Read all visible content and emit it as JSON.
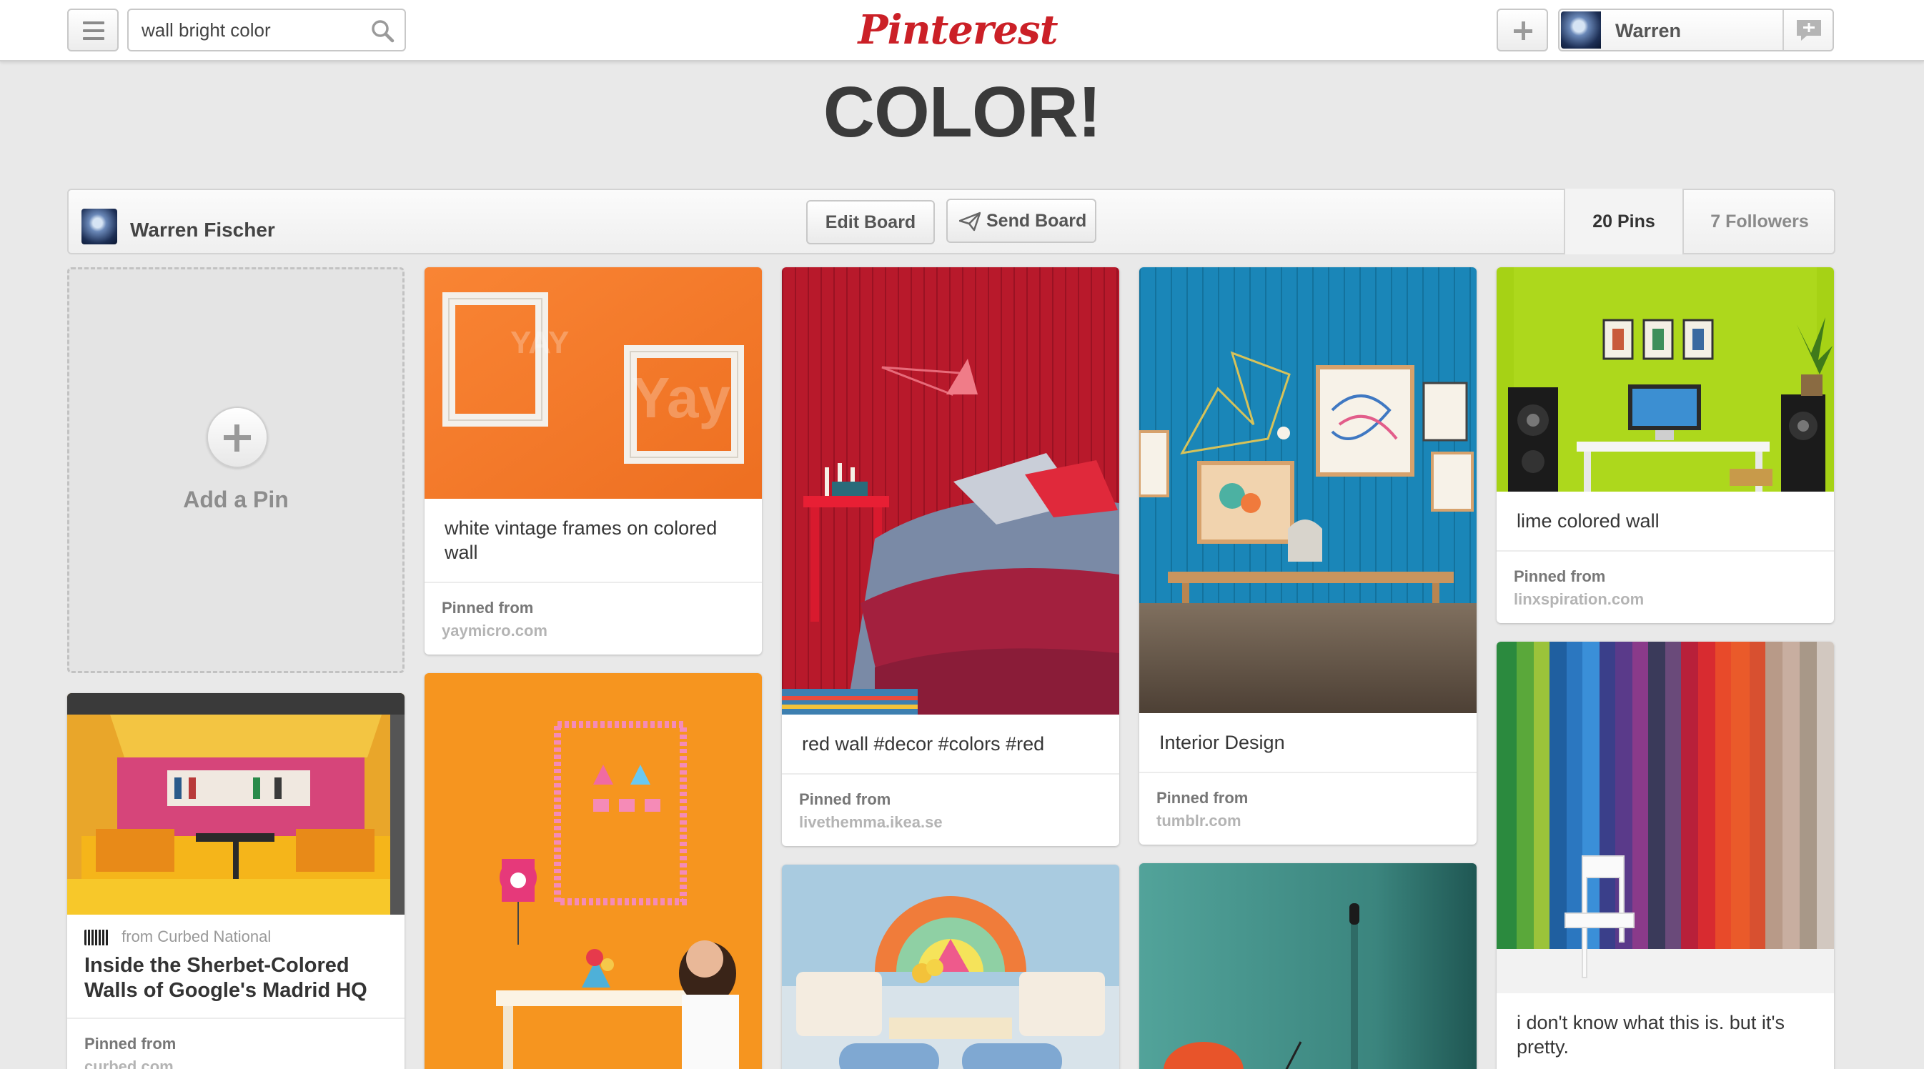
{
  "header": {
    "search": {
      "value": "wall bright color",
      "placeholder": "Search"
    },
    "logo": "Pinterest",
    "user": {
      "name": "Warren"
    }
  },
  "board": {
    "title": "COLOR!",
    "owner": "Warren Fischer",
    "edit_label": "Edit Board",
    "send_label": "Send Board",
    "pins_count": "20 Pins",
    "followers_count": "7 Followers"
  },
  "add_pin": {
    "label": "Add a Pin"
  },
  "pins": [
    {
      "image": "white-picture-frames-on-orange-wall",
      "description": "white vintage frames on colored wall",
      "pinned_label": "Pinned from",
      "source": "yaymicro.com"
    },
    {
      "image": "red-bedroom-wall-with-lamp-and-bed",
      "description": "red wall #decor #colors #red",
      "pinned_label": "Pinned from",
      "source": "livethemma.ikea.se"
    },
    {
      "image": "blue-wall-with-framed-art-and-bench",
      "description": "Interior Design",
      "pinned_label": "Pinned from",
      "source": "tumblr.com"
    },
    {
      "image": "lime-green-wall-home-office",
      "description": "lime colored wall",
      "pinned_label": "Pinned from",
      "source": "linxspiration.com"
    },
    {
      "image": "yellow-and-pink-meeting-booth",
      "via": "from Curbed National",
      "title": "Inside the Sherbet-Colored Walls of Google's Madrid HQ",
      "pinned_label": "Pinned from",
      "source": "curbed.com"
    },
    {
      "image": "orange-wall-kids-room-girl-drawing",
      "description": ""
    },
    {
      "image": "pastel-living-room-semicircle-art"
    },
    {
      "image": "teal-wall-room"
    },
    {
      "image": "rainbow-vertical-stripes-wall-white-chair",
      "description": "i don't know what this is. but it's pretty."
    }
  ],
  "colors": {
    "brand_red": "#cb2027",
    "background": "#e9e9e9"
  }
}
